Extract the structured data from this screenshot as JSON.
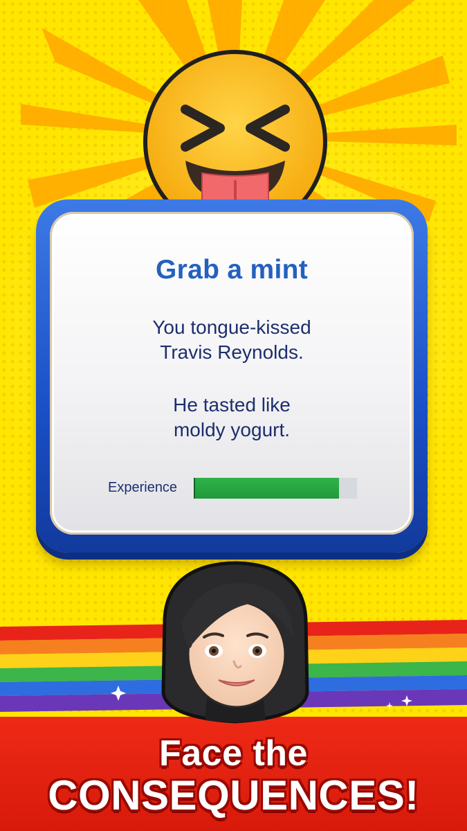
{
  "card": {
    "title": "Grab a mint",
    "message_line_1": "You tongue-kissed",
    "message_line_2": "Travis Reynolds.",
    "message_line_3": "He tasted like",
    "message_line_4": "moldy yogurt."
  },
  "experience": {
    "label": "Experience",
    "progress": 0.89
  },
  "headline": {
    "line_1": "Face the",
    "line_2": "CONSEQUENCES!"
  },
  "icons": {
    "top": "squinting-face-with-tongue-emoji",
    "bottom": "character-avatar"
  },
  "colors": {
    "background": "#ffe600",
    "card_border": "#1a4fc6",
    "title": "#2461bf",
    "text": "#1d2e6e",
    "progress": "#22a03d",
    "banner": "#e2200f"
  }
}
